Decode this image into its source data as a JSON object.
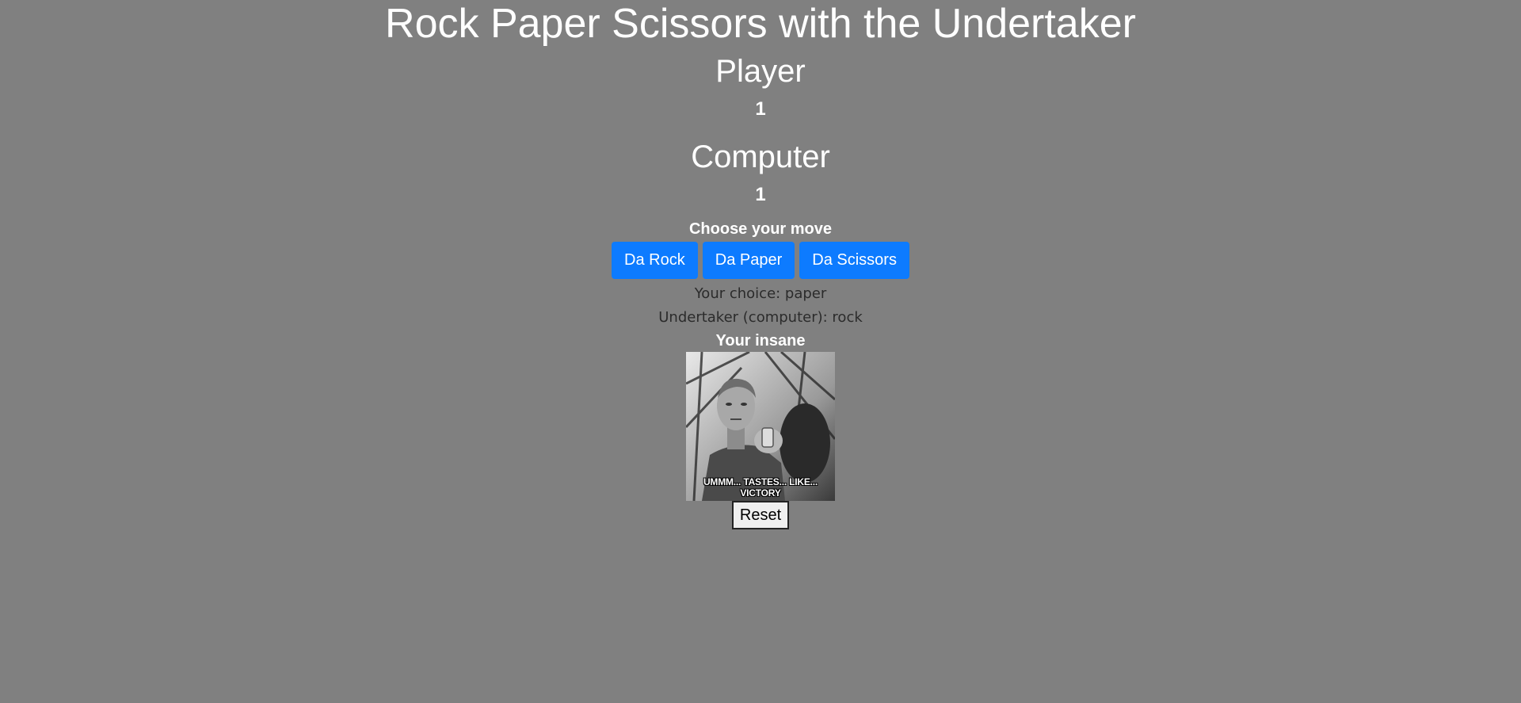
{
  "title": "Rock Paper Scissors with the Undertaker",
  "player": {
    "heading": "Player",
    "score": "1"
  },
  "computer": {
    "heading": "Computer",
    "score": "1"
  },
  "prompt": "Choose your move",
  "moves": {
    "rock_label": "Da Rock",
    "paper_label": "Da Paper",
    "scissors_label": "Da Scissors"
  },
  "result": {
    "your_choice": "Your choice: paper",
    "computer_choice": "Undertaker (computer): rock",
    "verdict": "Your insane"
  },
  "gif": {
    "caption": "UMMM... TASTES... LIKE... VICTORY"
  },
  "reset_label": "Reset",
  "colors": {
    "background": "#808080",
    "button": "#0d7bff",
    "text": "#ffffff",
    "result_text": "#2b2b2b"
  }
}
